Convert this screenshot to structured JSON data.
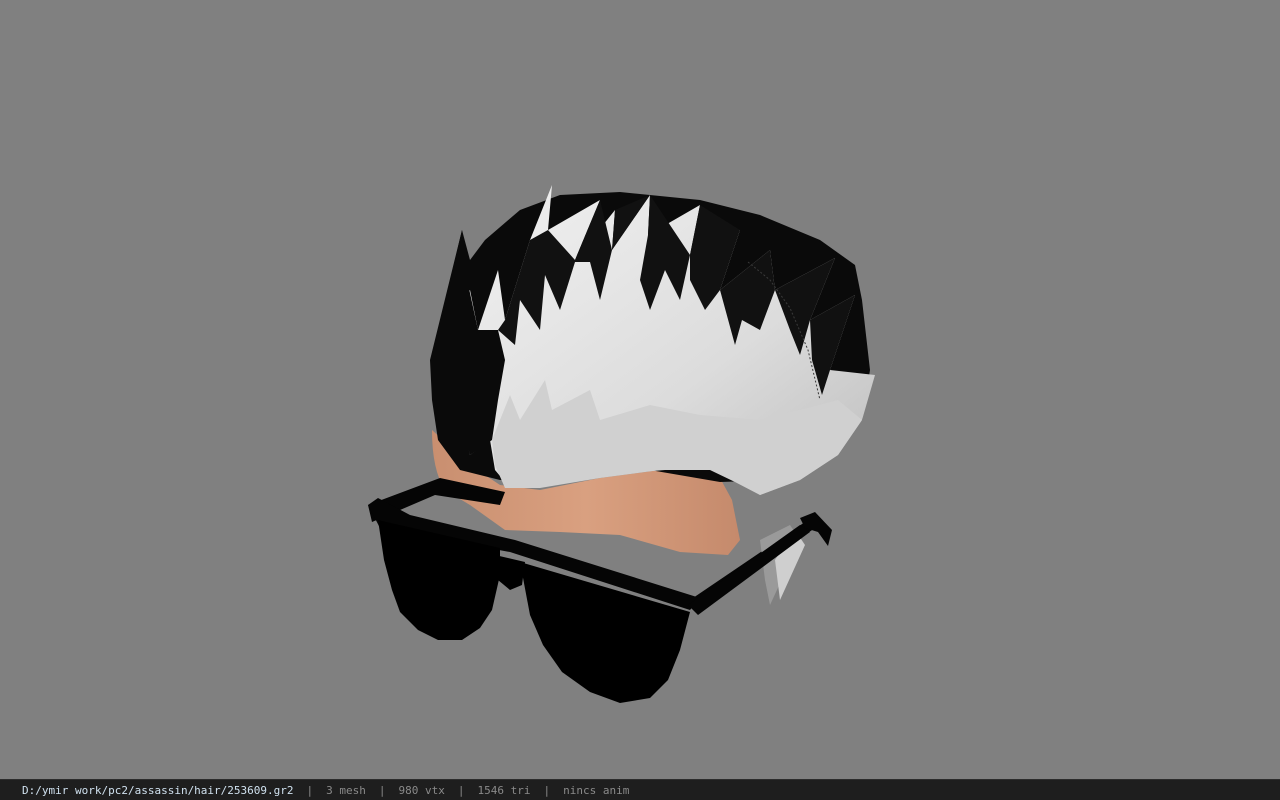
{
  "viewer": {
    "background_color": "#808080",
    "model_name": "hair-mesh-with-sunglasses"
  },
  "statusbar": {
    "file_path": "D:/ymir work/pc2/assassin/hair/253609.gr2",
    "mesh_count": "3 mesh",
    "vertex_count": "980 vtx",
    "triangle_count": "1546 tri",
    "anim_status": "nincs anim",
    "separator": "|"
  }
}
